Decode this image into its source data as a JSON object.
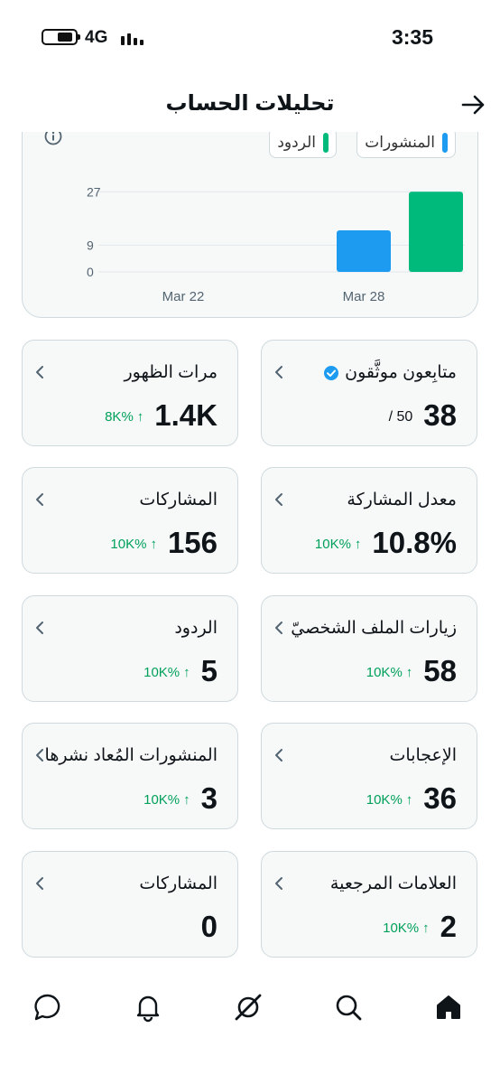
{
  "status_bar": {
    "network": "4G",
    "time": "3:35"
  },
  "header": {
    "title": "تحليلات الحساب"
  },
  "chart": {
    "legend": [
      {
        "label": "المنشورات",
        "color": "#1d9bf0"
      },
      {
        "label": "الردود",
        "color": "#00ba7c"
      }
    ]
  },
  "chart_data": {
    "type": "bar",
    "categories": [
      "Mar 22",
      "Mar 28"
    ],
    "x_tick_labels": [
      "Mar 22",
      "Mar 28"
    ],
    "series": [
      {
        "name": "المنشورات",
        "color": "#1d9bf0",
        "values": [
          0,
          14
        ]
      },
      {
        "name": "الردود",
        "color": "#00ba7c",
        "values": [
          0,
          27
        ]
      }
    ],
    "y_ticks": [
      0,
      9,
      27
    ],
    "ylim": [
      0,
      28
    ],
    "grid": true
  },
  "metrics": [
    {
      "label": "متابِعون موثَّقون",
      "value": "38",
      "sub": "/ 50",
      "verified": true
    },
    {
      "label": "مرات الظهور",
      "value": "1.4K",
      "change": "8K%"
    },
    {
      "label": "معدل المشاركة",
      "value": "10.8%",
      "change": "10K%"
    },
    {
      "label": "المشاركات",
      "value": "156",
      "change": "10K%"
    },
    {
      "label": "زيارات الملف الشخصيّ",
      "value": "58",
      "change": "10K%"
    },
    {
      "label": "الردود",
      "value": "5",
      "change": "10K%"
    },
    {
      "label": "الإعجابات",
      "value": "36",
      "change": "10K%"
    },
    {
      "label": "المنشورات المُعاد نشرها",
      "value": "3",
      "change": "10K%"
    },
    {
      "label": "العلامات المرجعية",
      "value": "2",
      "change": "10K%"
    },
    {
      "label": "المشاركات",
      "value": "0"
    }
  ],
  "colors": {
    "accent_blue": "#1d9bf0",
    "accent_green": "#00ba7c",
    "positive_change": "#00a05a"
  },
  "nav": [
    {
      "icon": "home-icon"
    },
    {
      "icon": "search-icon"
    },
    {
      "icon": "grok-icon"
    },
    {
      "icon": "bell-icon"
    },
    {
      "icon": "messages-icon"
    }
  ]
}
